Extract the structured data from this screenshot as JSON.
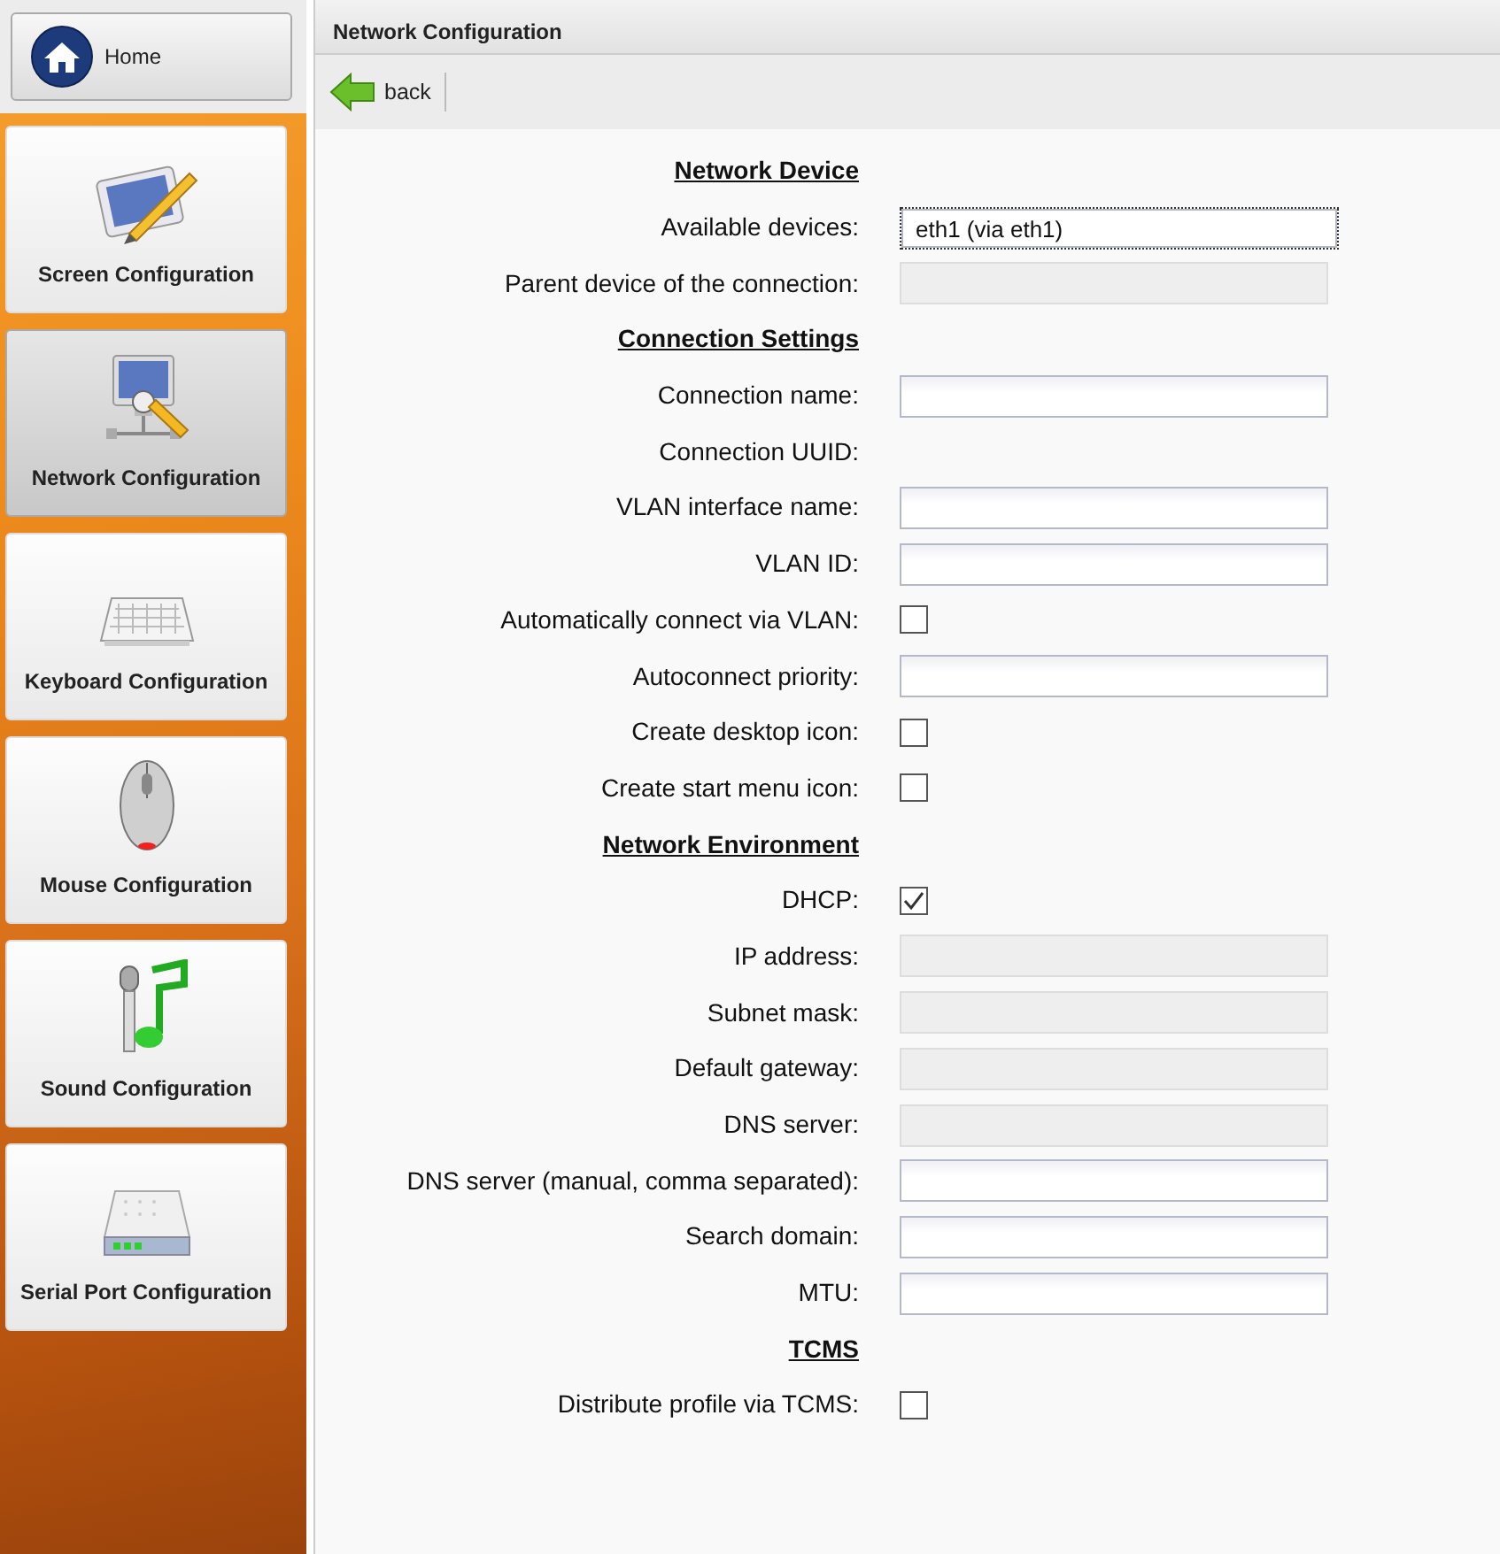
{
  "sidebar": {
    "home": {
      "label": "Home"
    },
    "items": [
      {
        "label": "Screen Configuration",
        "selected": false
      },
      {
        "label": "Network Configuration",
        "selected": true
      },
      {
        "label": "Keyboard Configuration",
        "selected": false
      },
      {
        "label": "Mouse Configuration",
        "selected": false
      },
      {
        "label": "Sound Configuration",
        "selected": false
      },
      {
        "label": "Serial Port Configuration",
        "selected": false
      }
    ]
  },
  "panel": {
    "title": "Network Configuration",
    "back": "back"
  },
  "form": [
    {
      "kind": "heading",
      "label": "Network Device"
    },
    {
      "kind": "select",
      "label": "Available devices:",
      "value": "eth1 (via eth1)"
    },
    {
      "kind": "text",
      "label": "Parent device of the connection:",
      "disabled": true
    },
    {
      "kind": "heading",
      "label": "Connection Settings"
    },
    {
      "kind": "text",
      "label": "Connection name:",
      "disabled": false
    },
    {
      "kind": "static",
      "label": "Connection UUID:"
    },
    {
      "kind": "text",
      "label": "VLAN interface name:",
      "disabled": false
    },
    {
      "kind": "text",
      "label": "VLAN ID:",
      "disabled": false
    },
    {
      "kind": "checkbox",
      "label": "Automatically connect via VLAN:",
      "checked": false
    },
    {
      "kind": "text",
      "label": "Autoconnect priority:",
      "disabled": false
    },
    {
      "kind": "checkbox",
      "label": "Create desktop icon:",
      "checked": false
    },
    {
      "kind": "checkbox",
      "label": "Create start menu icon:",
      "checked": false
    },
    {
      "kind": "heading",
      "label": "Network Environment"
    },
    {
      "kind": "checkbox",
      "label": "DHCP:",
      "checked": true
    },
    {
      "kind": "text",
      "label": "IP address:",
      "disabled": true
    },
    {
      "kind": "text",
      "label": "Subnet mask:",
      "disabled": true
    },
    {
      "kind": "text",
      "label": "Default gateway:",
      "disabled": true
    },
    {
      "kind": "text",
      "label": "DNS server:",
      "disabled": true
    },
    {
      "kind": "text",
      "label": "DNS server (manual, comma separated):",
      "disabled": false
    },
    {
      "kind": "text",
      "label": "Search domain:",
      "disabled": false
    },
    {
      "kind": "text",
      "label": "MTU:",
      "disabled": false
    },
    {
      "kind": "heading",
      "label": "TCMS"
    },
    {
      "kind": "checkbox",
      "label": "Distribute profile via TCMS:",
      "checked": false
    }
  ]
}
